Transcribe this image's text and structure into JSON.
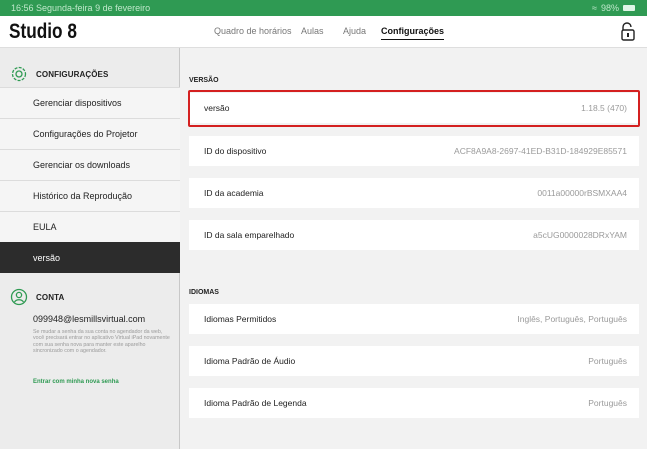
{
  "status_bar": {
    "time": "16:56  Segunda-feira 9 de fevereiro",
    "battery": "98%"
  },
  "header": {
    "title": "Studio 8",
    "tabs": [
      {
        "label": "Quadro de horários"
      },
      {
        "label": "Aulas"
      },
      {
        "label": "Ajuda"
      },
      {
        "label": "Configurações"
      }
    ],
    "active_tab": "Configurações"
  },
  "sidebar": {
    "settings_heading": "CONFIGURAÇÕES",
    "items": [
      {
        "label": "Gerenciar dispositivos"
      },
      {
        "label": "Configurações do Projetor"
      },
      {
        "label": "Gerenciar os downloads"
      },
      {
        "label": "Histórico da Reprodução"
      },
      {
        "label": "EULA"
      },
      {
        "label": "versão"
      }
    ],
    "selected_item": "versão",
    "account_heading": "CONTA",
    "account_email": "099948@lesmillsvirtual.com",
    "account_note": "Se mudar a senha da sua conta no agendador da web, você precisará entrar no aplicativo Virtual iPad novamente com sua senha nova para manter este aparelho sincronizado com o agendador.",
    "account_link": "Entrar com minha nova senha"
  },
  "content": {
    "version_heading": "VERSÃO",
    "version_rows": [
      {
        "label": "versão",
        "value": "1.18.5 (470)"
      },
      {
        "label": "ID do dispositivo",
        "value": "ACF8A9A8-2697-41ED-B31D-184929E85571"
      },
      {
        "label": "ID da academia",
        "value": "0011a00000rBSMXAA4"
      },
      {
        "label": "ID da sala emparelhado",
        "value": "a5cUG0000028DRxYAM"
      }
    ],
    "languages_heading": "IDIOMAS",
    "language_rows": [
      {
        "label": "Idiomas Permitidos",
        "value": "Inglês, Português, Português"
      },
      {
        "label": "Idioma Padrão de Áudio",
        "value": "Português"
      },
      {
        "label": "Idioma Padrão de Legenda",
        "value": "Português"
      }
    ]
  },
  "colors": {
    "accent": "#2f9a53",
    "highlight": "#d42020",
    "selected_bg": "#2c2c2c"
  },
  "icons": {
    "settings": "gear-icon",
    "account": "user-icon",
    "lock": "unlock-icon",
    "wifi": "wifi-icon",
    "battery": "battery-icon"
  }
}
